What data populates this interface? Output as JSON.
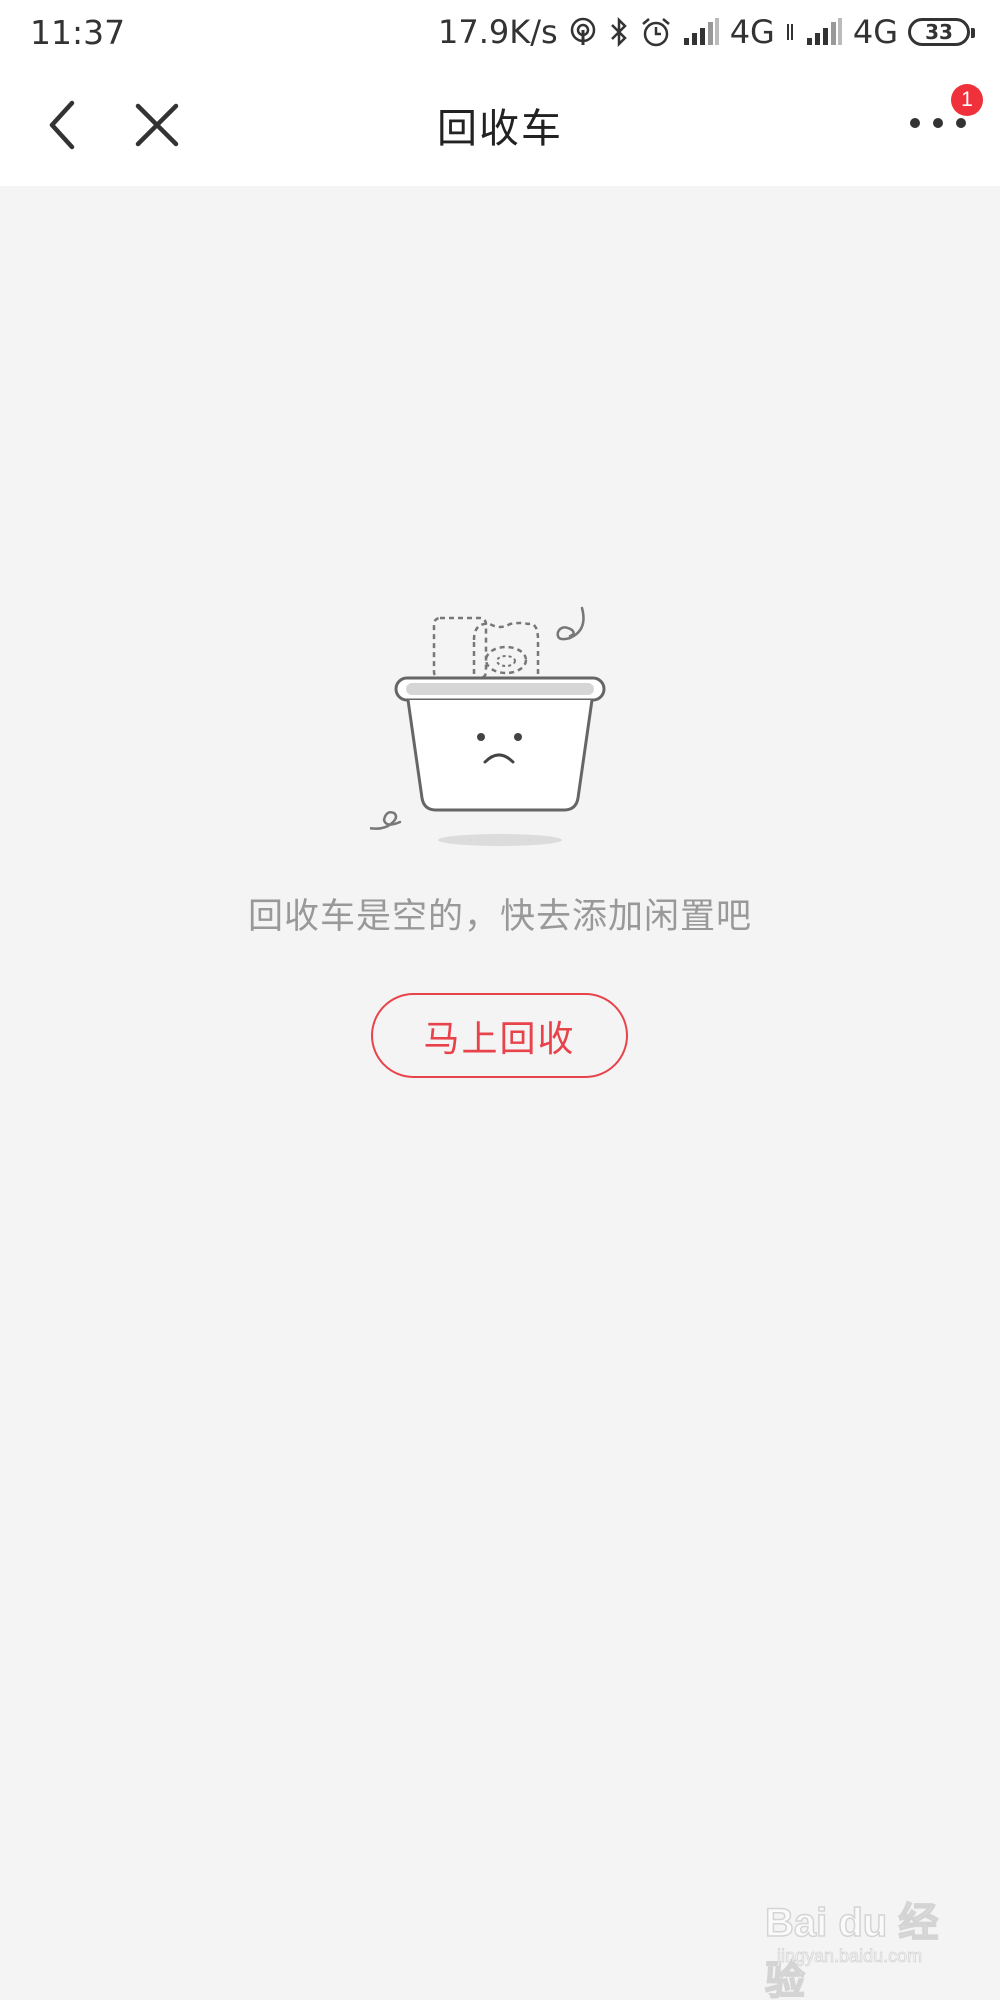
{
  "status_bar": {
    "time": "11:37",
    "network_speed": "17.9K/s",
    "signal_1_label": "4G",
    "signal_2_label": "4G",
    "battery_level": "33",
    "icons": [
      "hotspot-icon",
      "bluetooth-icon",
      "alarm-icon",
      "signal-icon",
      "signal-icon",
      "battery-icon"
    ]
  },
  "nav": {
    "title": "回收车",
    "more_badge": "1",
    "icons": [
      "back-arrow-icon",
      "close-icon",
      "more-icon"
    ]
  },
  "empty_state": {
    "illustration": "empty-basket-illustration",
    "message": "回收车是空的，快去添加闲置吧",
    "button_label": "马上回收",
    "accent_color": "#e8434b"
  },
  "watermark": {
    "brand": "Bai du 经验",
    "url": "jingyan.baidu.com"
  }
}
